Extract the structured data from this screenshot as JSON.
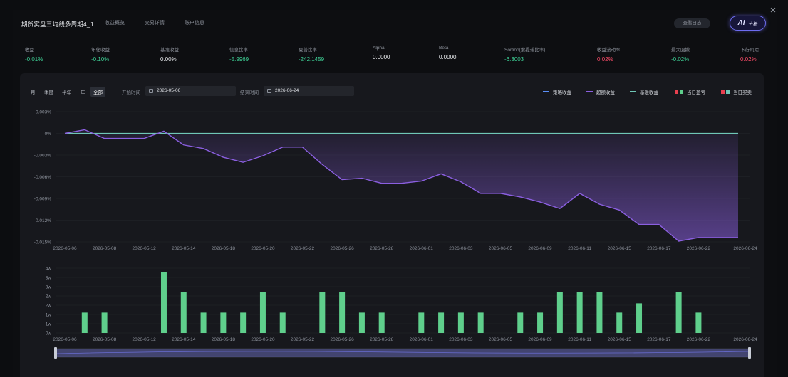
{
  "header": {
    "title": "期货实盘三均线多周期4_1",
    "tabs": [
      {
        "label": "收益概览",
        "active": true
      },
      {
        "label": "交易详情",
        "active": false
      },
      {
        "label": "账户信息",
        "active": false
      }
    ],
    "log_button": "查看日志",
    "ai_button": {
      "mark": "AI",
      "label": "分析"
    },
    "close_icon": "×"
  },
  "metrics": [
    {
      "label": "收益",
      "value": "-0.01%",
      "color": "green"
    },
    {
      "label": "年化收益",
      "value": "-0.10%",
      "color": "green"
    },
    {
      "label": "基准收益",
      "value": "0.00%",
      "color": "white"
    },
    {
      "label": "信息比率",
      "value": "-5.9969",
      "color": "green"
    },
    {
      "label": "夏普比率",
      "value": "-242.1459",
      "color": "green"
    },
    {
      "label": "Alpha",
      "value": "0.0000",
      "color": "white"
    },
    {
      "label": "Beta",
      "value": "0.0000",
      "color": "white"
    },
    {
      "label": "Sortino(索提诺比率)",
      "value": "-6.3003",
      "color": "green"
    },
    {
      "label": "收益波动率",
      "value": "0.02%",
      "color": "red"
    },
    {
      "label": "最大回撤",
      "value": "-0.02%",
      "color": "green"
    },
    {
      "label": "下行风险",
      "value": "0.02%",
      "color": "red"
    }
  ],
  "filters": {
    "periods": [
      {
        "label": "月",
        "active": false
      },
      {
        "label": "季度",
        "active": false
      },
      {
        "label": "半年",
        "active": false
      },
      {
        "label": "年",
        "active": false
      },
      {
        "label": "全部",
        "active": true
      }
    ],
    "start_label": "开始时间",
    "start_value": "2026-05-06",
    "end_label": "结束时间",
    "end_value": "2026-06-24"
  },
  "legend": [
    {
      "label": "策略收益",
      "kind": "line",
      "color": "#5b8ff9"
    },
    {
      "label": "超额收益",
      "kind": "line",
      "color": "#8b5fe0"
    },
    {
      "label": "基准收益",
      "kind": "line",
      "color": "#6fc7b6"
    },
    {
      "label": "当日盈亏",
      "kind": "pair",
      "colors": [
        "#e8404f",
        "#5fcf8c"
      ]
    },
    {
      "label": "当日买卖",
      "kind": "pair",
      "colors": [
        "#e8404f",
        "#6fc7b6"
      ]
    }
  ],
  "colors": {
    "strategy": "#5b8ff9",
    "excess": "#8b5fe0",
    "benchmark": "#6fc7b6",
    "profit": "#5fcf8c",
    "loss": "#e8404f",
    "green": "#3ed196",
    "red": "#ff4d6a"
  },
  "chart_data": [
    {
      "type": "line",
      "x_tick_labels": [
        "2026-05-06",
        "2026-05-08",
        "2026-05-12",
        "2026-05-14",
        "2026-05-18",
        "2026-05-20",
        "2026-05-22",
        "2026-05-26",
        "2026-05-28",
        "2026-06-01",
        "2026-06-03",
        "2026-06-05",
        "2026-06-09",
        "2026-06-11",
        "2026-06-15",
        "2026-06-17",
        "2026-06-22",
        "2026-06-24"
      ],
      "y_tick_labels": [
        "0.003%",
        "0%",
        "-0.003%",
        "-0.006%",
        "-0.009%",
        "-0.012%",
        "-0.015%"
      ],
      "ylim": [
        -0.015,
        0.003
      ],
      "series": [
        {
          "name": "超额收益",
          "fill": true,
          "values": [
            0.0,
            0.0005,
            -0.0007,
            -0.0007,
            -0.0007,
            0.0003,
            -0.0016,
            -0.0021,
            -0.0033,
            -0.004,
            -0.0031,
            -0.0019,
            -0.0019,
            -0.0043,
            -0.0064,
            -0.0062,
            -0.0069,
            -0.0069,
            -0.0066,
            -0.0056,
            -0.0067,
            -0.0083,
            -0.0083,
            -0.0088,
            -0.0095,
            -0.0104,
            -0.0083,
            -0.0098,
            -0.0106,
            -0.0126,
            -0.0126,
            -0.0149,
            -0.0144,
            -0.0144,
            -0.0144
          ]
        },
        {
          "name": "基准收益",
          "values": [
            0,
            0,
            0,
            0,
            0,
            0,
            0,
            0,
            0,
            0,
            0,
            0,
            0,
            0,
            0,
            0,
            0,
            0,
            0,
            0,
            0,
            0,
            0,
            0,
            0,
            0,
            0,
            0,
            0,
            0,
            0,
            0,
            0,
            0,
            0
          ]
        }
      ]
    },
    {
      "type": "bar",
      "y_tick_labels": [
        "4w",
        "3w",
        "3w",
        "2w",
        "2w",
        "1w",
        "1w",
        "0w"
      ],
      "ylim": [
        0,
        35000
      ],
      "series": [
        {
          "name": "当日买卖",
          "values": [
            0,
            11000,
            11000,
            0,
            0,
            33000,
            22000,
            11000,
            11000,
            11000,
            22000,
            11000,
            0,
            22000,
            22000,
            11000,
            11000,
            0,
            11000,
            11000,
            11000,
            11000,
            0,
            11000,
            11000,
            22000,
            22000,
            22000,
            11000,
            16000,
            0,
            22000,
            11000,
            0,
            0
          ]
        }
      ]
    }
  ]
}
